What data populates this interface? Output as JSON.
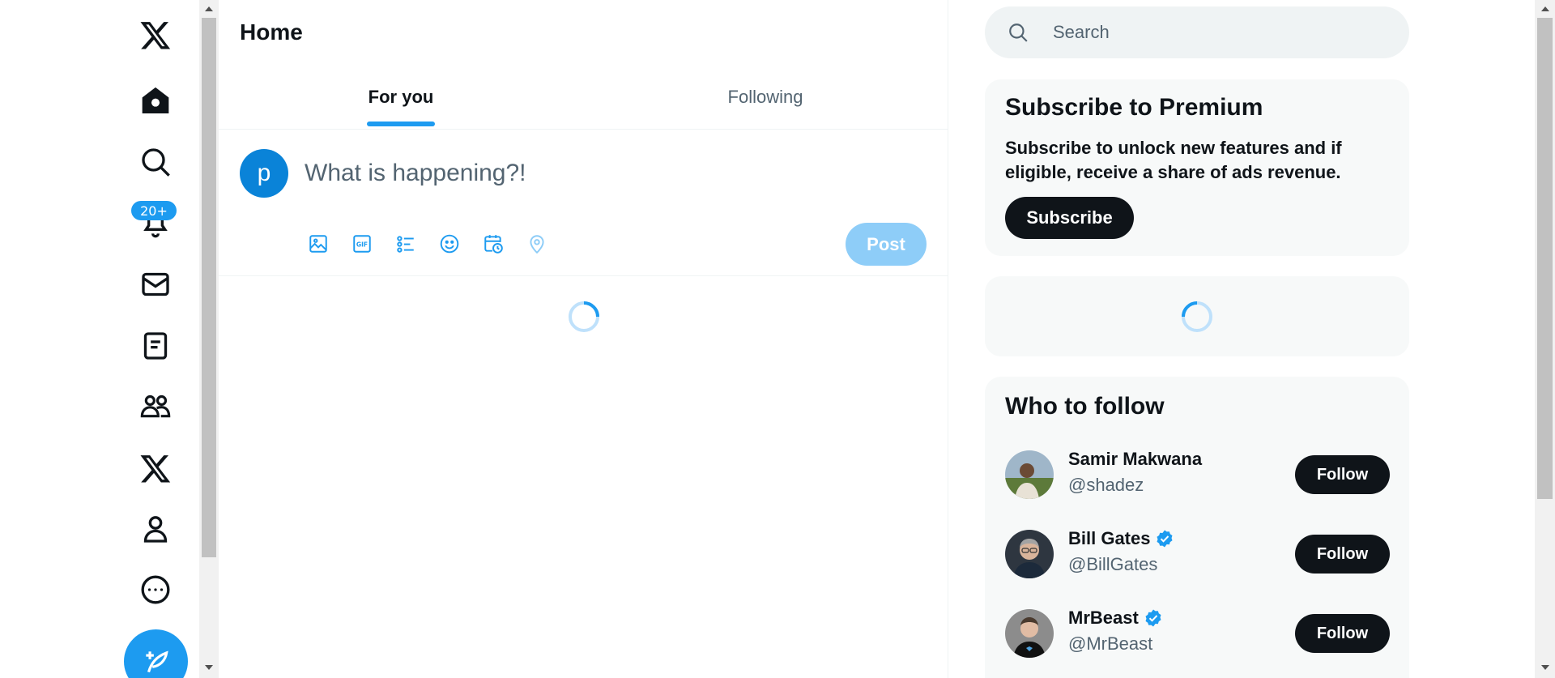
{
  "nav": {
    "items": [
      {
        "name": "x-logo-icon",
        "label": "X"
      },
      {
        "name": "home-icon",
        "label": "Home"
      },
      {
        "name": "search-icon",
        "label": "Explore"
      },
      {
        "name": "bell-icon",
        "label": "Notifications"
      },
      {
        "name": "mail-icon",
        "label": "Messages"
      },
      {
        "name": "lists-icon",
        "label": "Lists"
      },
      {
        "name": "communities-icon",
        "label": "Communities"
      },
      {
        "name": "premium-x-icon",
        "label": "Premium"
      },
      {
        "name": "profile-icon",
        "label": "Profile"
      },
      {
        "name": "more-icon",
        "label": "More"
      }
    ],
    "notifications_badge": "20+",
    "compose_icon": "feather-plus-icon"
  },
  "main": {
    "title": "Home",
    "tabs": [
      {
        "label": "For you",
        "active": true
      },
      {
        "label": "Following",
        "active": false
      }
    ],
    "composer": {
      "avatar_letter": "p",
      "placeholder": "What is happening?!",
      "tools": [
        "media-icon",
        "gif-icon",
        "poll-icon",
        "emoji-icon",
        "schedule-icon",
        "location-icon"
      ],
      "post_label": "Post"
    }
  },
  "right": {
    "search_placeholder": "Search",
    "premium": {
      "title": "Subscribe to Premium",
      "body": "Subscribe to unlock new features and if eligible, receive a share of ads revenue.",
      "button": "Subscribe"
    },
    "who_to_follow": {
      "title": "Who to follow",
      "people": [
        {
          "name": "Samir Makwana",
          "handle": "@shadez",
          "verified": false,
          "button": "Follow"
        },
        {
          "name": "Bill Gates",
          "handle": "@BillGates",
          "verified": true,
          "button": "Follow"
        },
        {
          "name": "MrBeast",
          "handle": "@MrBeast",
          "verified": true,
          "button": "Follow"
        }
      ]
    }
  },
  "colors": {
    "accent": "#1d9bf0",
    "text": "#0f1419",
    "muted": "#536471",
    "post_disabled": "#8ecdf8"
  }
}
